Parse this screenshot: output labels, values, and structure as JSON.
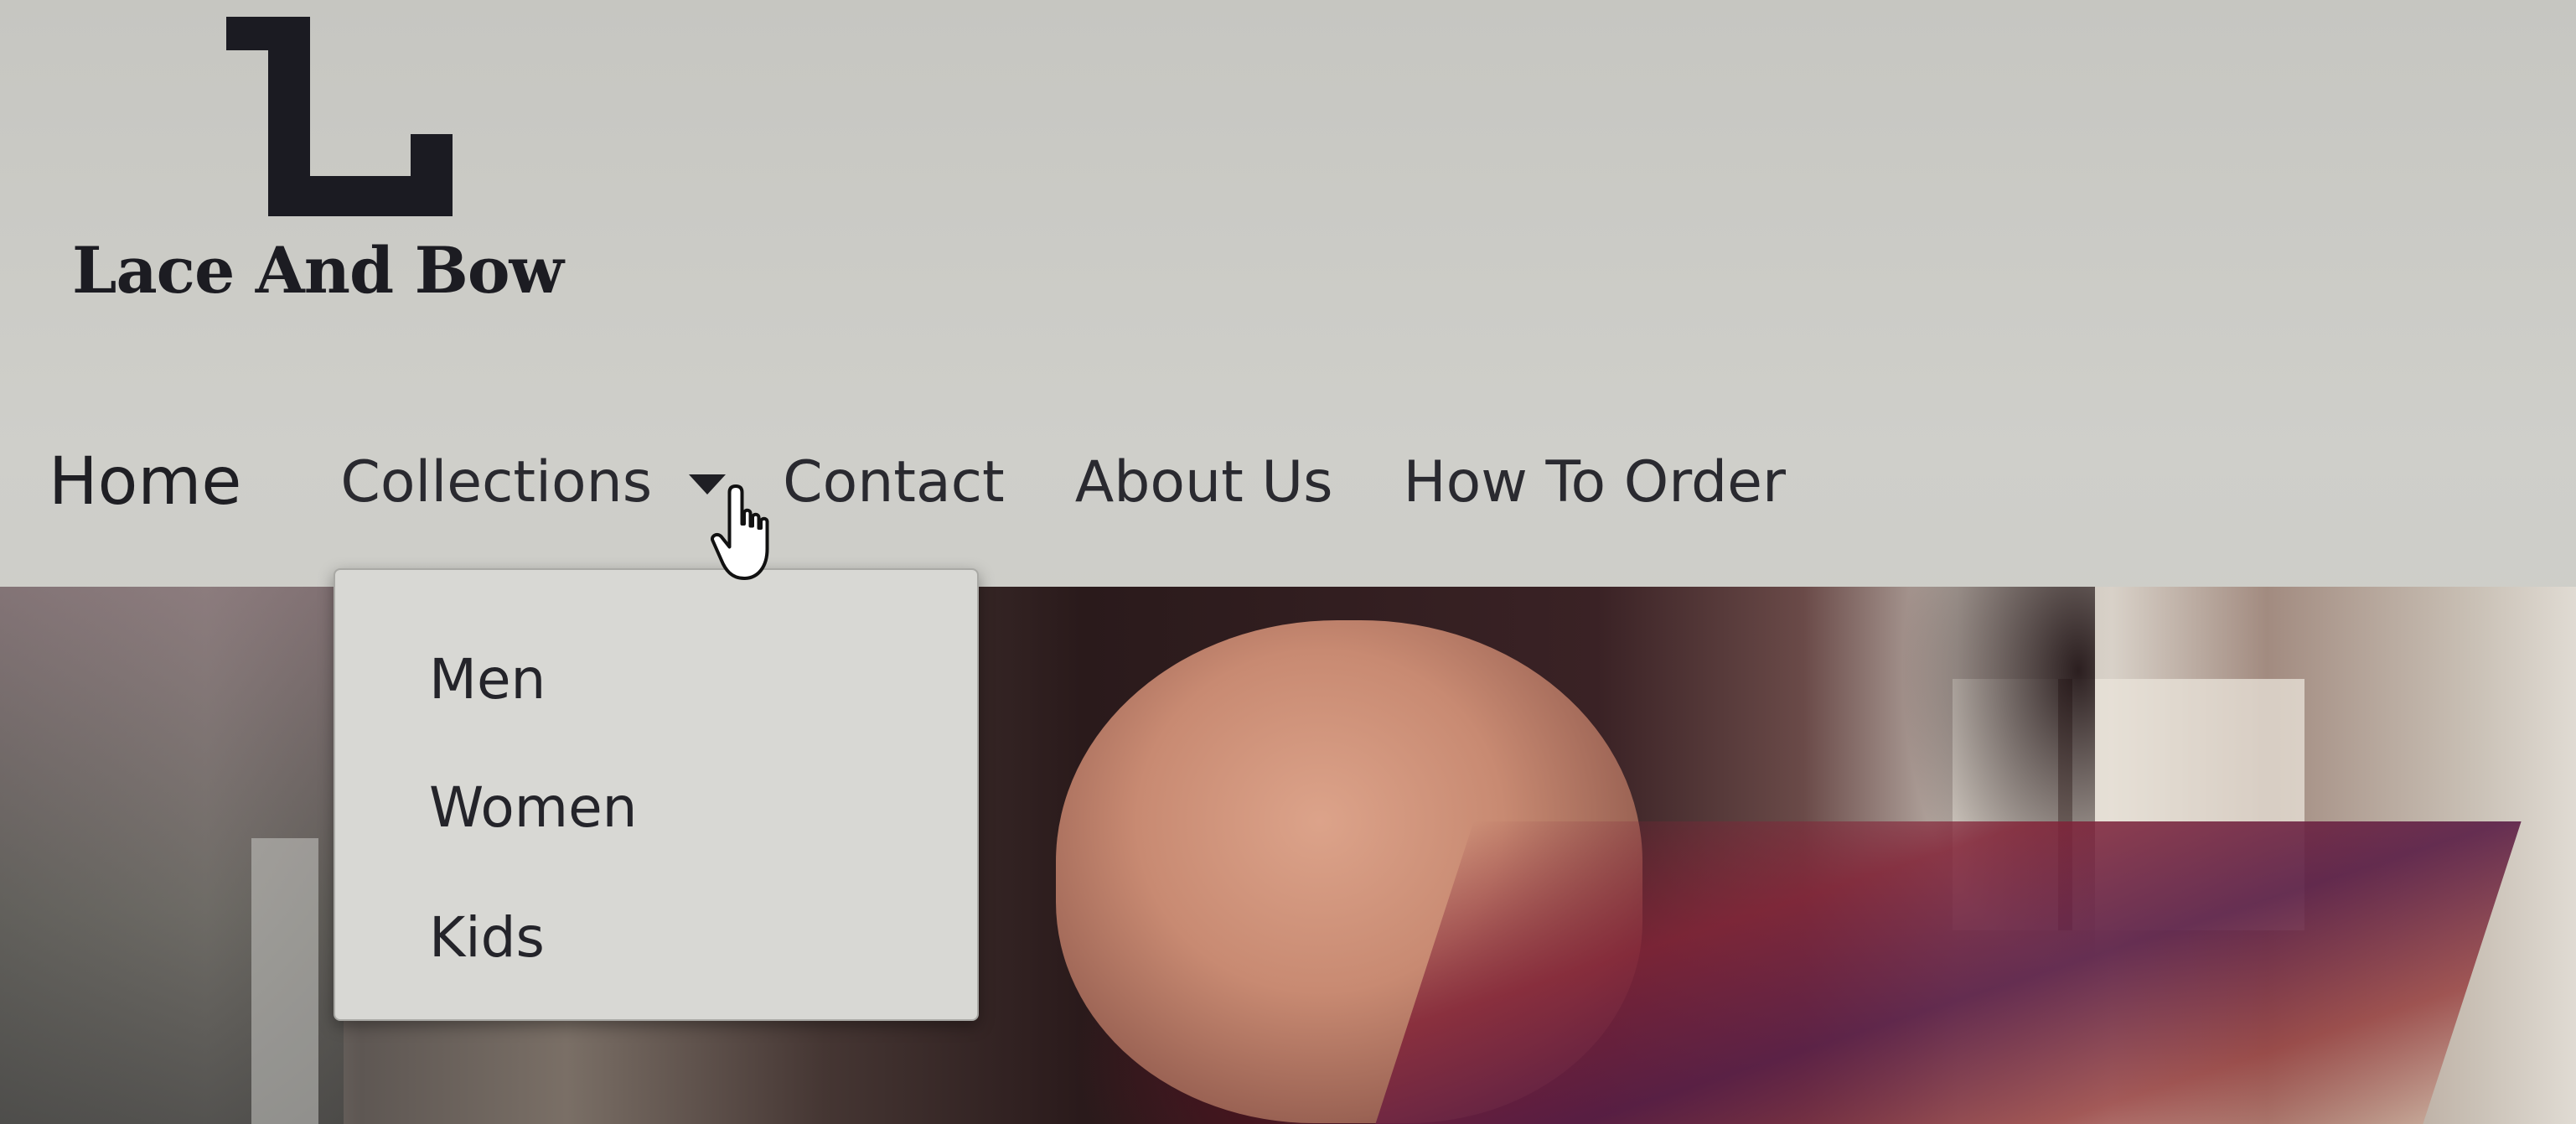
{
  "brand": {
    "logo_letter": "L",
    "name": "Lace And Bow"
  },
  "nav": {
    "items": [
      {
        "label": "Home"
      },
      {
        "label": "Collections",
        "has_dropdown": true
      },
      {
        "label": "Contact"
      },
      {
        "label": "About Us"
      },
      {
        "label": "How To Order"
      }
    ]
  },
  "dropdown": {
    "parent": "Collections",
    "items": [
      {
        "label": "Men"
      },
      {
        "label": "Women"
      },
      {
        "label": "Kids"
      }
    ]
  },
  "icons": {
    "caret": "caret-down-icon",
    "cursor": "hand-pointer-cursor-icon"
  },
  "colors": {
    "text": "#24242a",
    "background": "#c9c9c4",
    "dropdown_bg": "#d8d8d4"
  }
}
